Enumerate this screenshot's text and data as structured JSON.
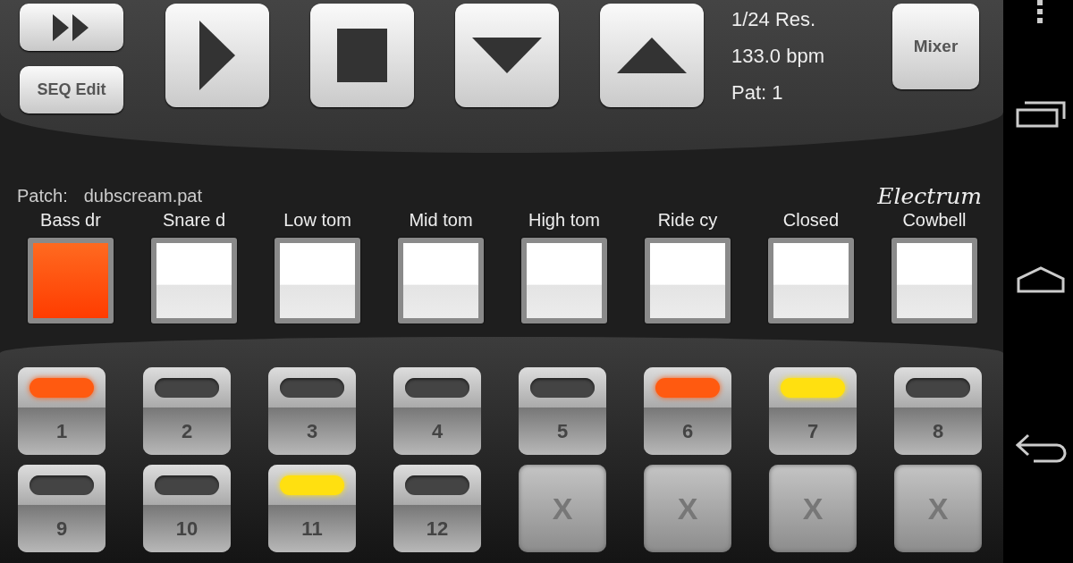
{
  "top_buttons": [
    {
      "kind": "fast-forward"
    },
    {
      "kind": "text",
      "label": "SEQ Edit"
    }
  ],
  "transport": [
    {
      "kind": "play"
    },
    {
      "kind": "stop"
    },
    {
      "kind": "down"
    },
    {
      "kind": "up"
    }
  ],
  "info": [
    "1/24 Res.",
    "133.0 bpm",
    "Pat: 1"
  ],
  "mixer_button": "Mixer",
  "patch": {
    "label": "Patch:",
    "value": "dubscream.pat"
  },
  "logo": "Electrum",
  "pads": [
    {
      "label": "Bass dr",
      "selected": true
    },
    {
      "label": "Snare d",
      "selected": false
    },
    {
      "label": "Low tom",
      "selected": false
    },
    {
      "label": "Mid tom",
      "selected": false
    },
    {
      "label": "High tom",
      "selected": false
    },
    {
      "label": "Ride cy",
      "selected": false
    },
    {
      "label": "Closed",
      "selected": false
    },
    {
      "label": "Cowbell",
      "selected": false
    }
  ],
  "steps": [
    {
      "kind": "step",
      "label": "1",
      "lit": true,
      "color": "#ff5a10"
    },
    {
      "kind": "step",
      "label": "2",
      "lit": false
    },
    {
      "kind": "step",
      "label": "3",
      "lit": false
    },
    {
      "kind": "step",
      "label": "4",
      "lit": false
    },
    {
      "kind": "step",
      "label": "5",
      "lit": false
    },
    {
      "kind": "step",
      "label": "6",
      "lit": true,
      "color": "#ff5a10"
    },
    {
      "kind": "step",
      "label": "7",
      "lit": true,
      "color": "#ffe010"
    },
    {
      "kind": "step",
      "label": "8",
      "lit": false
    },
    {
      "kind": "step",
      "label": "9",
      "lit": false
    },
    {
      "kind": "step",
      "label": "10",
      "lit": false
    },
    {
      "kind": "step",
      "label": "11",
      "lit": true,
      "color": "#ffe010"
    },
    {
      "kind": "step",
      "label": "12",
      "lit": false
    },
    {
      "kind": "disabled",
      "label": "X"
    },
    {
      "kind": "disabled",
      "label": "X"
    },
    {
      "kind": "disabled",
      "label": "X"
    },
    {
      "kind": "disabled",
      "label": "X"
    }
  ]
}
